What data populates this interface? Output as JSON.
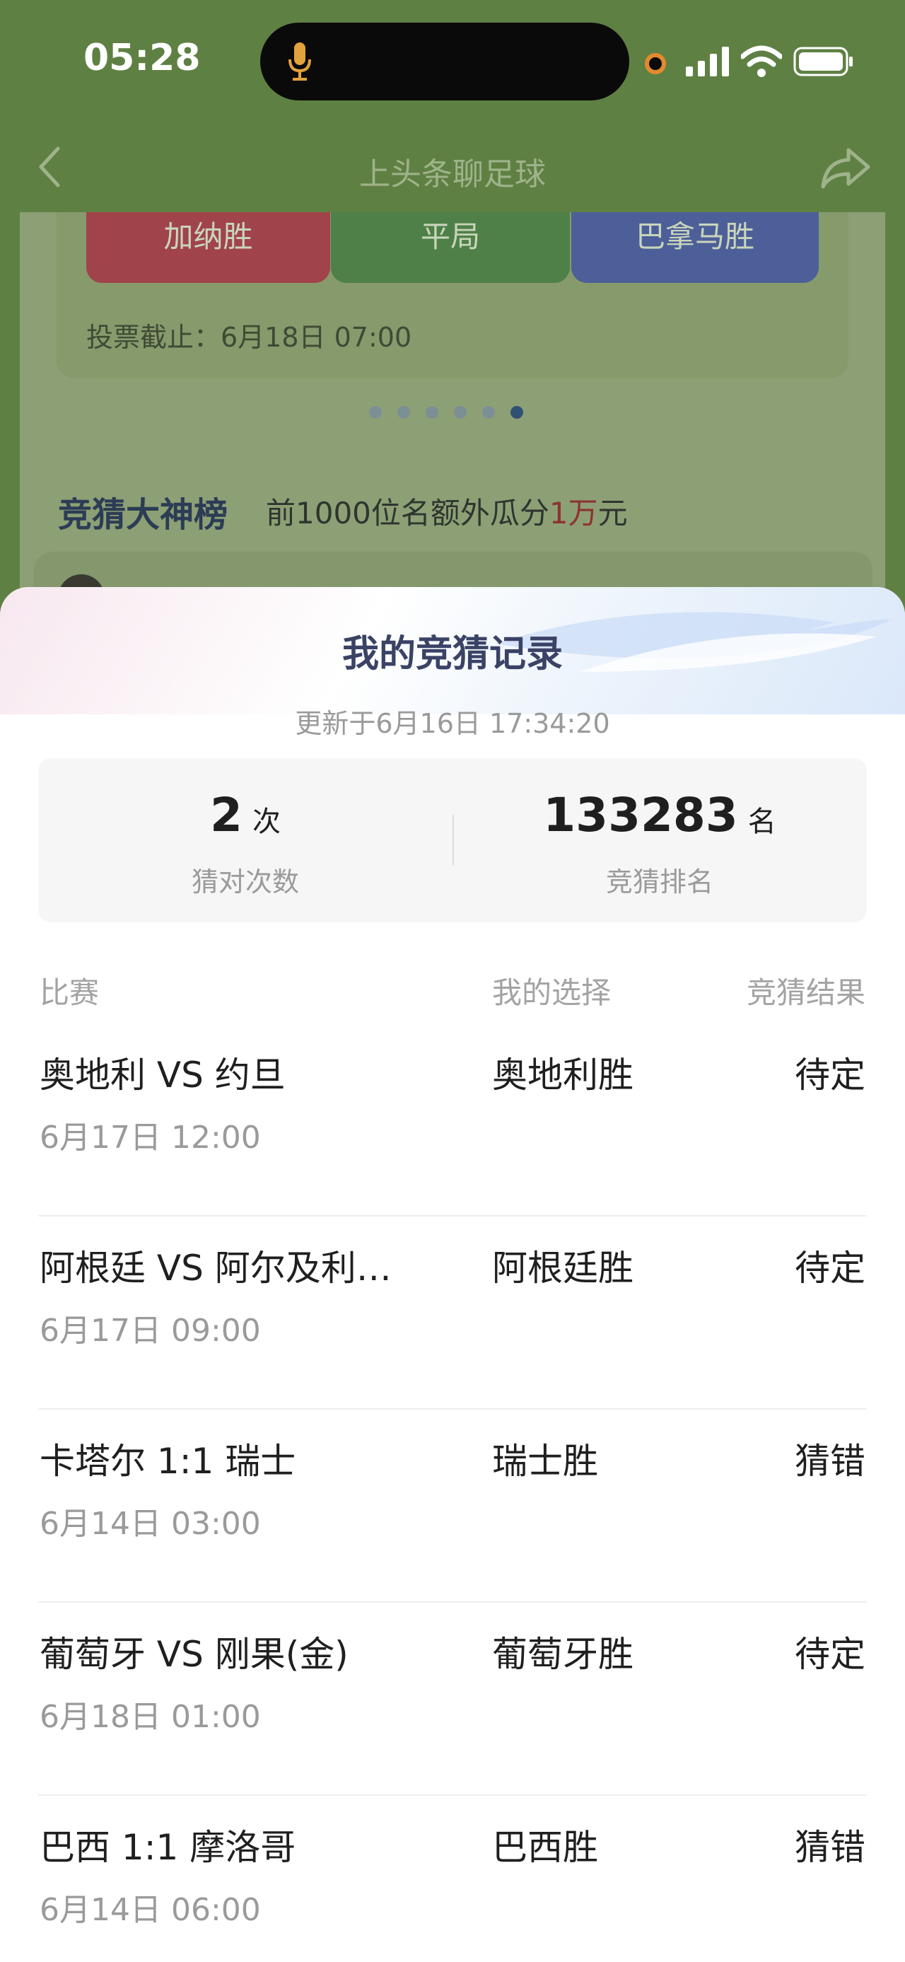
{
  "status_bar": {
    "time": "05:28"
  },
  "nav": {
    "title": "上头条聊足球"
  },
  "background": {
    "vote_options": [
      "加纳胜",
      "平局",
      "巴拿马胜"
    ],
    "deadline": "投票截止：6月18日 07:00",
    "leaderboard_title": "竞猜大神榜",
    "leaderboard_sub_prefix": "前1000位名额外瓜分",
    "leaderboard_sub_highlight": "1万",
    "leaderboard_sub_suffix": "元"
  },
  "sheet": {
    "title": "我的竞猜记录",
    "updated": "更新于6月16日 17:34:20",
    "stats": {
      "correct_count": "2",
      "correct_unit": "次",
      "correct_label": "猜对次数",
      "rank": "133283",
      "rank_unit": "名",
      "rank_label": "竞猜排名"
    },
    "columns": {
      "match": "比赛",
      "choice": "我的选择",
      "result": "竞猜结果"
    },
    "rows": [
      {
        "match": "奥地利 VS 约旦",
        "datetime": "6月17日 12:00",
        "choice": "奥地利胜",
        "result": "待定"
      },
      {
        "match": "阿根廷 VS 阿尔及利…",
        "datetime": "6月17日 09:00",
        "choice": "阿根廷胜",
        "result": "待定"
      },
      {
        "match": "卡塔尔 1:1 瑞士",
        "datetime": "6月14日 03:00",
        "choice": "瑞士胜",
        "result": "猜错"
      },
      {
        "match": "葡萄牙 VS 刚果(金)",
        "datetime": "6月18日 01:00",
        "choice": "葡萄牙胜",
        "result": "待定"
      },
      {
        "match": "巴西 1:1 摩洛哥",
        "datetime": "6月14日 06:00",
        "choice": "巴西胜",
        "result": "猜错"
      }
    ]
  }
}
